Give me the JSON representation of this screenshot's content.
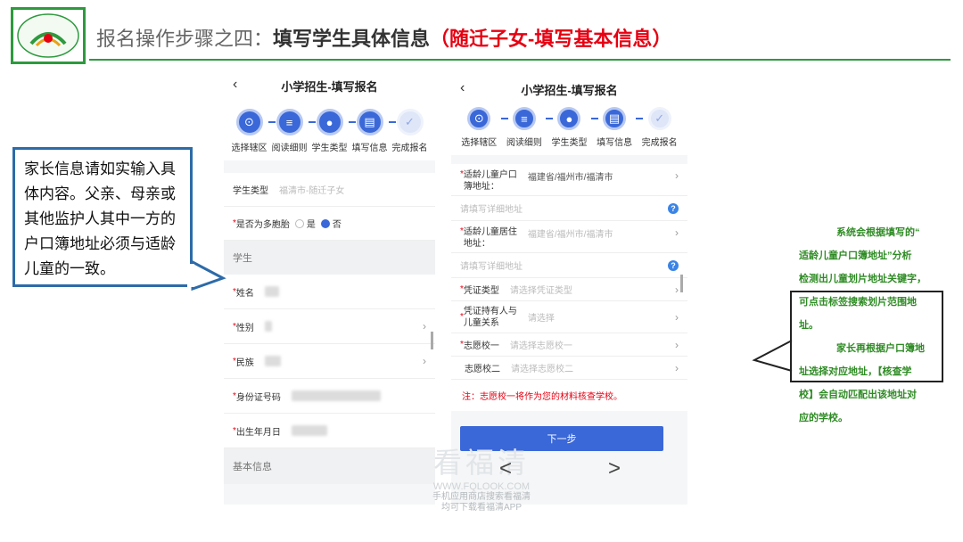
{
  "slide": {
    "title_prefix": "报名操作步骤之四：",
    "title_bold": "填写学生具体信息",
    "title_red": "（随迁子女-填写基本信息）"
  },
  "phone1": {
    "title": "小学招生-填写报名",
    "back": "‹",
    "steps": [
      {
        "label": "选择辖区",
        "icon": "location-icon",
        "active": true
      },
      {
        "label": "阅读细则",
        "icon": "document-icon",
        "active": true
      },
      {
        "label": "学生类型",
        "icon": "person-icon",
        "active": true
      },
      {
        "label": "填写信息",
        "icon": "form-icon",
        "active": true
      },
      {
        "label": "完成报名",
        "icon": "check-icon",
        "active": false
      }
    ],
    "student_type_label": "学生类型",
    "student_type_value": "福清市-随迁子女",
    "multiple_label": "是否为多胞胎",
    "yes": "是",
    "no": "否",
    "section_student": "学生",
    "name_label": "姓名",
    "gender_label": "性别",
    "ethnicity_label": "民族",
    "id_label": "身份证号码",
    "birth_label": "出生年月日",
    "section_basic": "基本信息"
  },
  "phone2": {
    "title": "小学招生-填写报名",
    "back": "‹",
    "steps": [
      {
        "label": "选择辖区",
        "icon": "location-icon",
        "active": true
      },
      {
        "label": "阅读细则",
        "icon": "document-icon",
        "active": true
      },
      {
        "label": "学生类型",
        "icon": "person-icon",
        "active": true
      },
      {
        "label": "填写信息",
        "icon": "form-icon",
        "active": true
      },
      {
        "label": "完成报名",
        "icon": "check-icon",
        "active": false
      }
    ],
    "hukou_label_1": "适龄儿童户口",
    "hukou_label_2": "簿地址：",
    "hukou_value": "福建省/福州市/福清市",
    "hukou_detail_placeholder": "请填写详细地址",
    "residence_label_1": "适龄儿童居住",
    "residence_label_2": "地址：",
    "residence_value": "福建省/福州市/福清市",
    "residence_detail_placeholder": "请填写详细地址",
    "cert_label": "凭证类型",
    "cert_placeholder": "请选择凭证类型",
    "holder_label_1": "凭证持有人与",
    "holder_label_2": "儿童关系",
    "holder_placeholder": "请选择",
    "school1_label": "志愿校一",
    "school1_placeholder": "请选择志愿校一",
    "school2_label": "志愿校二",
    "school2_placeholder": "请选择志愿校二",
    "note": "注：志愿校一将作为您的材料核查学校。",
    "next_button": "下一步"
  },
  "callout_left": "家长信息请如实输入具体内容。父亲、母亲或其他监护人其中一方的户口簿地址必须与适龄儿童的一致。",
  "right_text": {
    "line1": "系统会根据填写的“",
    "line2": "适龄儿童户口簿地址”分析",
    "line3": "检测出儿童划片地址关键字，",
    "line4": "可点击标签搜索划片范围地",
    "line5": "址。",
    "line6": "家长再根据户口簿地",
    "line7": "址选择对应地址，【核查学",
    "line8": "校】会自动匹配出该地址对",
    "line9": "应的学校。"
  },
  "watermark": {
    "big": "看福清",
    "url": "WWW.FQLOOK.COM",
    "line1": "手机应用商店搜索看福清",
    "line2": "均可下载看福清APP"
  },
  "nav": {
    "prev": "<",
    "next": ">"
  },
  "colors": {
    "green": "#2e9a3e",
    "blue": "#3a68d8",
    "red": "#e60012",
    "callout_border": "#2d6ba8"
  }
}
